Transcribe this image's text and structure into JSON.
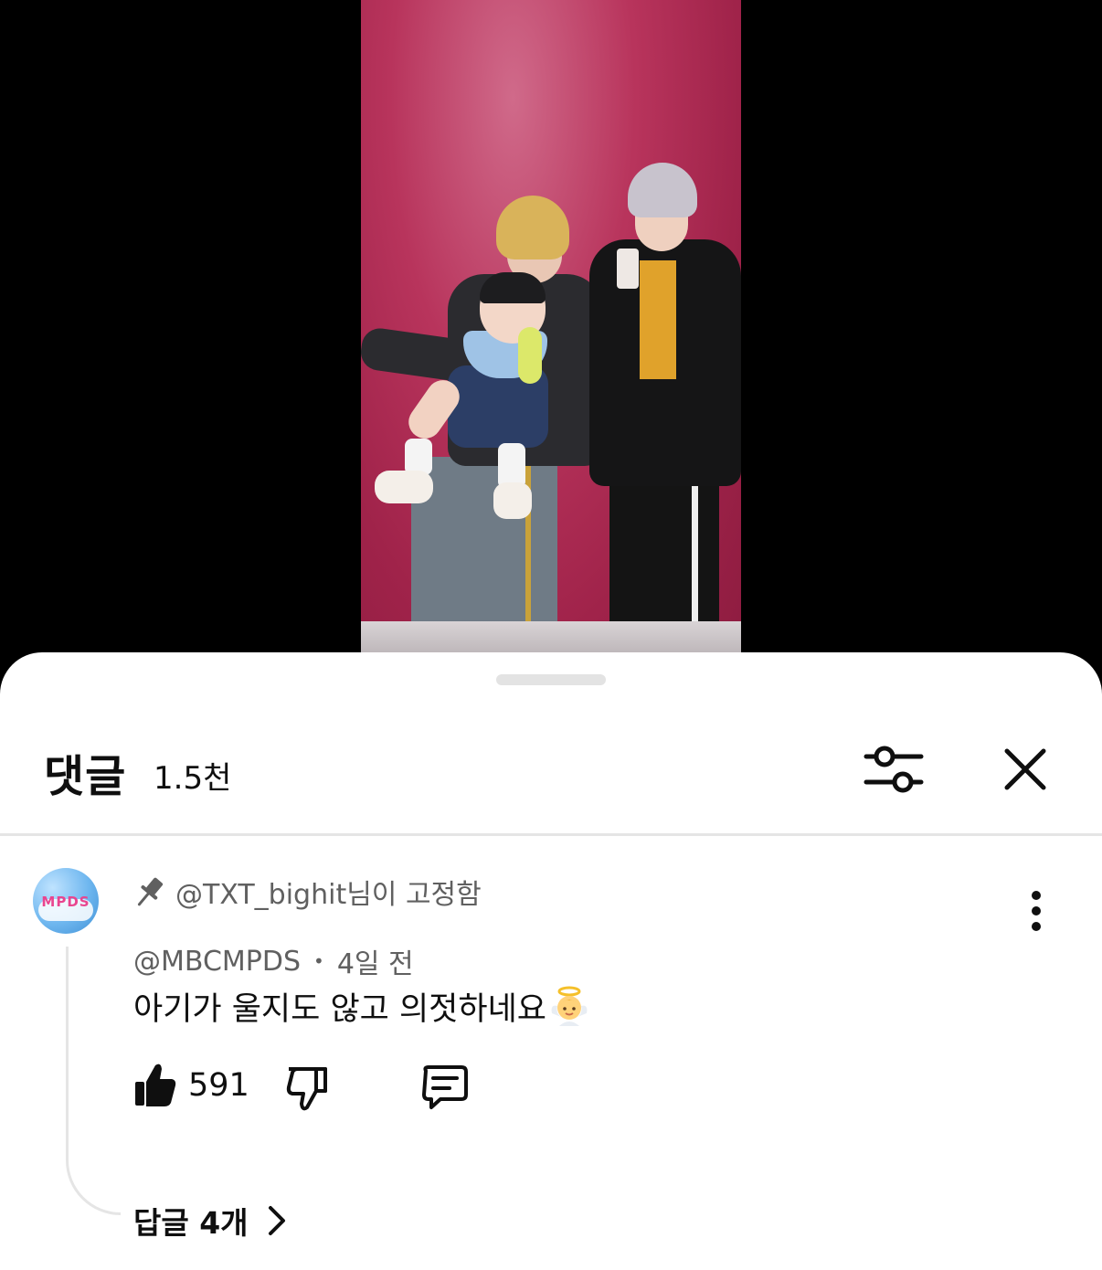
{
  "comments_panel": {
    "title": "댓글",
    "count": "1.5천"
  },
  "comment": {
    "avatar_text": "MPDS",
    "pinned_by": "@TXT_bighit님이 고정함",
    "author": "@MBCMPDS",
    "separator": "•",
    "time": "4일 전",
    "text": "아기가 울지도 않고 의젓하네요",
    "emoji": "baby-angel-emoji",
    "likes": "591",
    "replies_label": "답글 4개"
  },
  "colors": {
    "secondary_text": "#606060",
    "divider": "#e5e5e5",
    "video_background": "#a0234a"
  }
}
